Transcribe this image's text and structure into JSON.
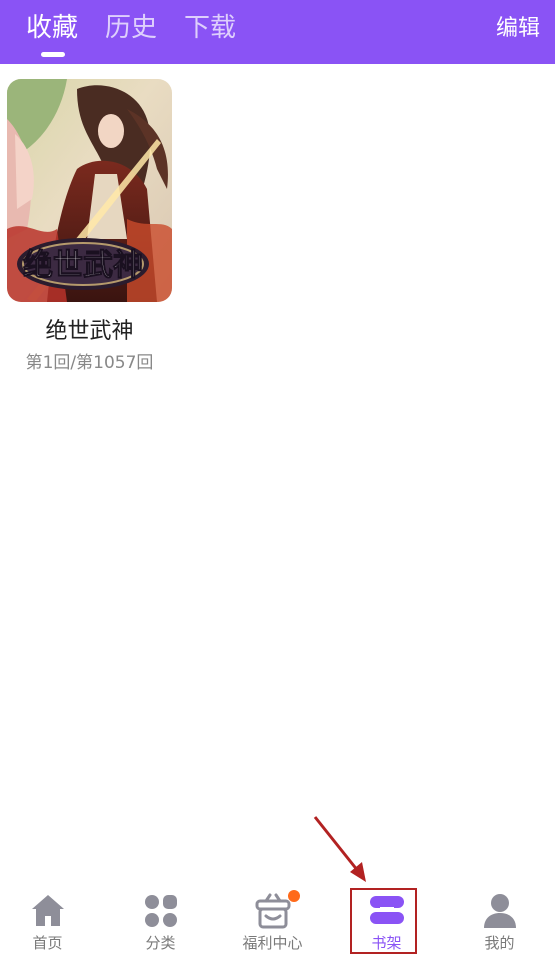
{
  "topbar": {
    "tabs": [
      {
        "label": "收藏",
        "active": true
      },
      {
        "label": "历史",
        "active": false
      },
      {
        "label": "下载",
        "active": false
      }
    ],
    "edit_label": "编辑",
    "background_color": "#8a53f5"
  },
  "favorites": [
    {
      "title": "绝世武神",
      "progress": "第1回/第1057回",
      "cover_logo_text": "绝世武神"
    }
  ],
  "bottom_nav": {
    "items": [
      {
        "label": "首页",
        "icon": "home-icon",
        "active": false
      },
      {
        "label": "分类",
        "icon": "category-icon",
        "active": false
      },
      {
        "label": "福利中心",
        "icon": "gift-box-icon",
        "active": false,
        "has_badge": true
      },
      {
        "label": "书架",
        "icon": "bookshelf-icon",
        "active": true
      },
      {
        "label": "我的",
        "icon": "profile-icon",
        "active": false
      }
    ],
    "active_color": "#8a53f5",
    "inactive_color": "#8e8e99",
    "badge_color": "#ff6a1a"
  },
  "annotation": {
    "highlight_color": "#b22222"
  }
}
